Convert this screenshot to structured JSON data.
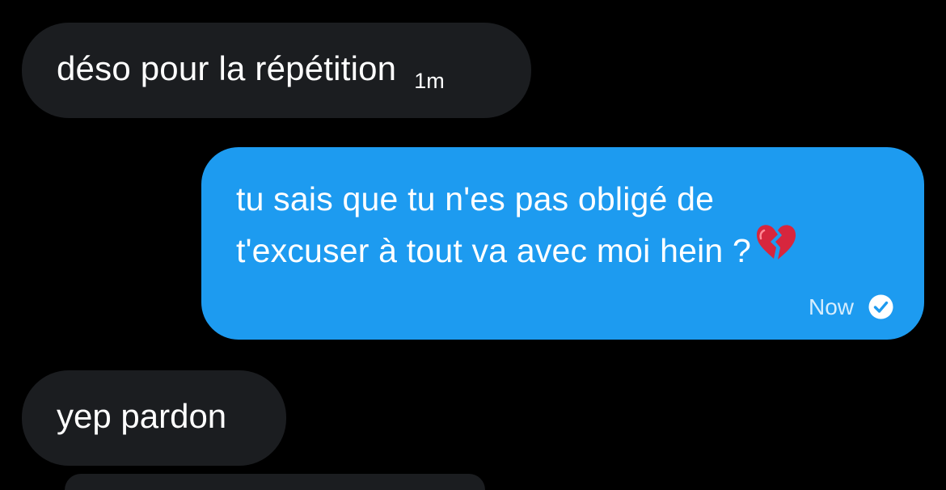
{
  "conversation": {
    "messages": [
      {
        "direction": "incoming",
        "text": "déso pour la répétition",
        "time": "1m"
      },
      {
        "direction": "outgoing",
        "lines": [
          "tu sais que tu n'es pas obligé de",
          "t'excuser à tout va avec moi hein ?"
        ],
        "emoji": "broken-heart-emoji",
        "time": "Now",
        "status_icon": "check-circle-icon"
      },
      {
        "direction": "incoming",
        "text": "yep pardon"
      }
    ]
  },
  "colors": {
    "background": "#000000",
    "incoming_bubble": "#1b1d20",
    "outgoing_bubble": "#1d9bf0",
    "text": "#ffffff"
  }
}
